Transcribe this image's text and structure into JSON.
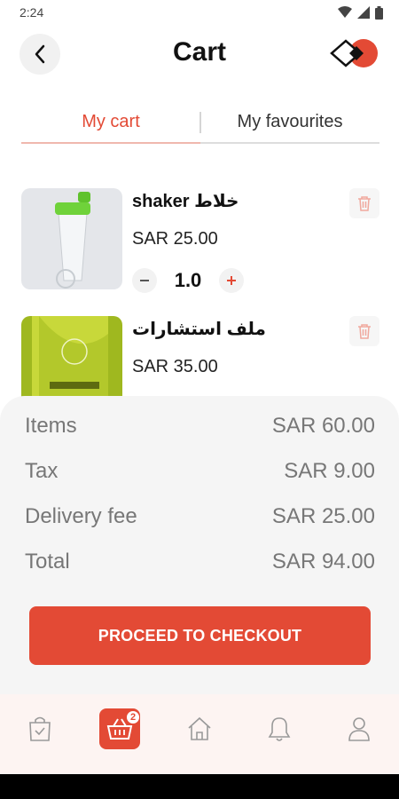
{
  "status_bar": {
    "time": "2:24"
  },
  "header": {
    "title": "Cart",
    "back_icon": "chevron-left-icon"
  },
  "tabs": [
    {
      "label": "My cart",
      "active": true
    },
    {
      "label": "My favourites",
      "active": false
    }
  ],
  "items": [
    {
      "name": "shaker خلاط",
      "price": "SAR 25.00",
      "quantity": "1.0"
    },
    {
      "name": "ملف استشارات",
      "price": "SAR 35.00"
    }
  ],
  "summary": {
    "rows": [
      {
        "label": "Items",
        "value": "SAR 60.00"
      },
      {
        "label": "Tax",
        "value": "SAR 9.00"
      },
      {
        "label": "Delivery fee",
        "value": "SAR 25.00"
      },
      {
        "label": "Total",
        "value": "SAR 94.00"
      }
    ],
    "checkout_label": "PROCEED TO CHECKOUT"
  },
  "bottom_nav": {
    "cart_badge": "2",
    "items": [
      "orders-bag-icon",
      "cart-basket-icon",
      "home-icon",
      "bell-icon",
      "profile-icon"
    ]
  },
  "colors": {
    "accent": "#e34a35",
    "summary_bg": "#f5f5f5",
    "nav_bg": "#fdf4f2"
  }
}
